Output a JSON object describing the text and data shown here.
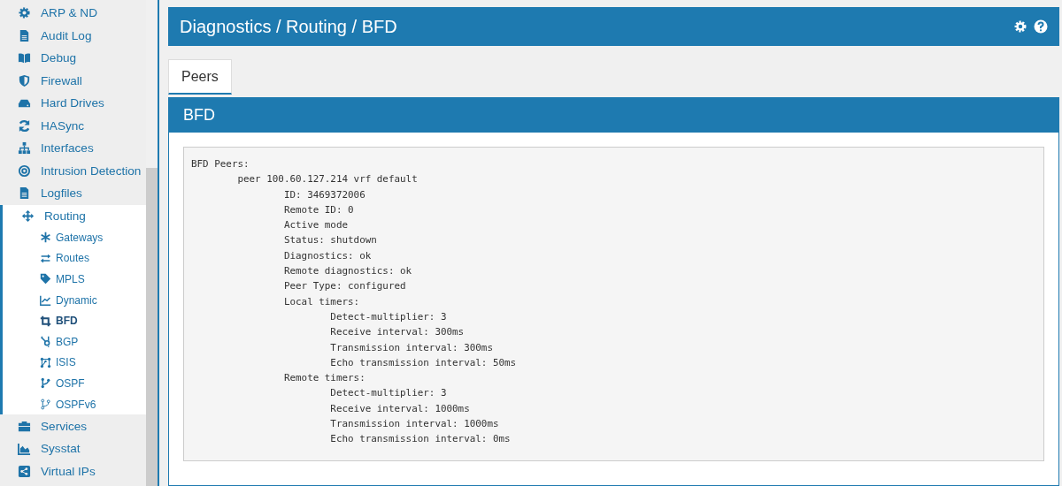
{
  "sidebar": {
    "items": [
      {
        "label": "ARP & ND",
        "selected": false
      },
      {
        "label": "Audit Log",
        "selected": false
      },
      {
        "label": "Debug",
        "selected": false
      },
      {
        "label": "Firewall",
        "selected": false
      },
      {
        "label": "Hard Drives",
        "selected": false
      },
      {
        "label": "HASync",
        "selected": false
      },
      {
        "label": "Interfaces",
        "selected": false
      },
      {
        "label": "Intrusion Detection",
        "selected": false
      },
      {
        "label": "Logfiles",
        "selected": false
      },
      {
        "label": "Routing",
        "selected": false,
        "expanded": true,
        "children": [
          {
            "label": "Gateways",
            "selected": false
          },
          {
            "label": "Routes",
            "selected": false
          },
          {
            "label": "MPLS",
            "selected": false
          },
          {
            "label": "Dynamic",
            "selected": false
          },
          {
            "label": "BFD",
            "selected": true
          },
          {
            "label": "BGP",
            "selected": false
          },
          {
            "label": "ISIS",
            "selected": false
          },
          {
            "label": "OSPF",
            "selected": false
          },
          {
            "label": "OSPFv6",
            "selected": false
          }
        ]
      },
      {
        "label": "Services",
        "selected": false
      },
      {
        "label": "Sysstat",
        "selected": false
      },
      {
        "label": "Virtual IPs",
        "selected": false
      }
    ]
  },
  "header": {
    "title": "Diagnostics / Routing / BFD"
  },
  "tabs": [
    {
      "label": "Peers",
      "selected": true
    }
  ],
  "panel": {
    "title": "BFD",
    "output": "BFD Peers:\n        peer 100.60.127.214 vrf default\n                ID: 3469372006\n                Remote ID: 0\n                Active mode\n                Status: shutdown\n                Diagnostics: ok\n                Remote diagnostics: ok\n                Peer Type: configured\n                Local timers:\n                        Detect-multiplier: 3\n                        Receive interval: 300ms\n                        Transmission interval: 300ms\n                        Echo transmission interval: 50ms\n                Remote timers:\n                        Detect-multiplier: 3\n                        Receive interval: 1000ms\n                        Transmission interval: 1000ms\n                        Echo transmission interval: 0ms"
  }
}
